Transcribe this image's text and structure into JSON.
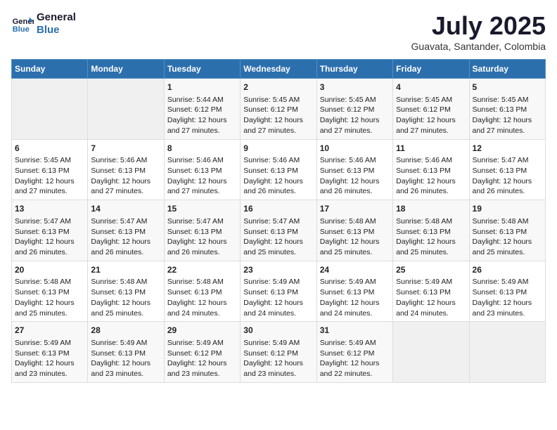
{
  "logo": {
    "line1": "General",
    "line2": "Blue"
  },
  "title": "July 2025",
  "subtitle": "Guavata, Santander, Colombia",
  "days_of_week": [
    "Sunday",
    "Monday",
    "Tuesday",
    "Wednesday",
    "Thursday",
    "Friday",
    "Saturday"
  ],
  "weeks": [
    [
      {
        "day": "",
        "empty": true
      },
      {
        "day": "",
        "empty": true
      },
      {
        "day": "1",
        "sunrise": "Sunrise: 5:44 AM",
        "sunset": "Sunset: 6:12 PM",
        "daylight": "Daylight: 12 hours and 27 minutes."
      },
      {
        "day": "2",
        "sunrise": "Sunrise: 5:45 AM",
        "sunset": "Sunset: 6:12 PM",
        "daylight": "Daylight: 12 hours and 27 minutes."
      },
      {
        "day": "3",
        "sunrise": "Sunrise: 5:45 AM",
        "sunset": "Sunset: 6:12 PM",
        "daylight": "Daylight: 12 hours and 27 minutes."
      },
      {
        "day": "4",
        "sunrise": "Sunrise: 5:45 AM",
        "sunset": "Sunset: 6:12 PM",
        "daylight": "Daylight: 12 hours and 27 minutes."
      },
      {
        "day": "5",
        "sunrise": "Sunrise: 5:45 AM",
        "sunset": "Sunset: 6:13 PM",
        "daylight": "Daylight: 12 hours and 27 minutes."
      }
    ],
    [
      {
        "day": "6",
        "sunrise": "Sunrise: 5:45 AM",
        "sunset": "Sunset: 6:13 PM",
        "daylight": "Daylight: 12 hours and 27 minutes."
      },
      {
        "day": "7",
        "sunrise": "Sunrise: 5:46 AM",
        "sunset": "Sunset: 6:13 PM",
        "daylight": "Daylight: 12 hours and 27 minutes."
      },
      {
        "day": "8",
        "sunrise": "Sunrise: 5:46 AM",
        "sunset": "Sunset: 6:13 PM",
        "daylight": "Daylight: 12 hours and 27 minutes."
      },
      {
        "day": "9",
        "sunrise": "Sunrise: 5:46 AM",
        "sunset": "Sunset: 6:13 PM",
        "daylight": "Daylight: 12 hours and 26 minutes."
      },
      {
        "day": "10",
        "sunrise": "Sunrise: 5:46 AM",
        "sunset": "Sunset: 6:13 PM",
        "daylight": "Daylight: 12 hours and 26 minutes."
      },
      {
        "day": "11",
        "sunrise": "Sunrise: 5:46 AM",
        "sunset": "Sunset: 6:13 PM",
        "daylight": "Daylight: 12 hours and 26 minutes."
      },
      {
        "day": "12",
        "sunrise": "Sunrise: 5:47 AM",
        "sunset": "Sunset: 6:13 PM",
        "daylight": "Daylight: 12 hours and 26 minutes."
      }
    ],
    [
      {
        "day": "13",
        "sunrise": "Sunrise: 5:47 AM",
        "sunset": "Sunset: 6:13 PM",
        "daylight": "Daylight: 12 hours and 26 minutes."
      },
      {
        "day": "14",
        "sunrise": "Sunrise: 5:47 AM",
        "sunset": "Sunset: 6:13 PM",
        "daylight": "Daylight: 12 hours and 26 minutes."
      },
      {
        "day": "15",
        "sunrise": "Sunrise: 5:47 AM",
        "sunset": "Sunset: 6:13 PM",
        "daylight": "Daylight: 12 hours and 26 minutes."
      },
      {
        "day": "16",
        "sunrise": "Sunrise: 5:47 AM",
        "sunset": "Sunset: 6:13 PM",
        "daylight": "Daylight: 12 hours and 25 minutes."
      },
      {
        "day": "17",
        "sunrise": "Sunrise: 5:48 AM",
        "sunset": "Sunset: 6:13 PM",
        "daylight": "Daylight: 12 hours and 25 minutes."
      },
      {
        "day": "18",
        "sunrise": "Sunrise: 5:48 AM",
        "sunset": "Sunset: 6:13 PM",
        "daylight": "Daylight: 12 hours and 25 minutes."
      },
      {
        "day": "19",
        "sunrise": "Sunrise: 5:48 AM",
        "sunset": "Sunset: 6:13 PM",
        "daylight": "Daylight: 12 hours and 25 minutes."
      }
    ],
    [
      {
        "day": "20",
        "sunrise": "Sunrise: 5:48 AM",
        "sunset": "Sunset: 6:13 PM",
        "daylight": "Daylight: 12 hours and 25 minutes."
      },
      {
        "day": "21",
        "sunrise": "Sunrise: 5:48 AM",
        "sunset": "Sunset: 6:13 PM",
        "daylight": "Daylight: 12 hours and 25 minutes."
      },
      {
        "day": "22",
        "sunrise": "Sunrise: 5:48 AM",
        "sunset": "Sunset: 6:13 PM",
        "daylight": "Daylight: 12 hours and 24 minutes."
      },
      {
        "day": "23",
        "sunrise": "Sunrise: 5:49 AM",
        "sunset": "Sunset: 6:13 PM",
        "daylight": "Daylight: 12 hours and 24 minutes."
      },
      {
        "day": "24",
        "sunrise": "Sunrise: 5:49 AM",
        "sunset": "Sunset: 6:13 PM",
        "daylight": "Daylight: 12 hours and 24 minutes."
      },
      {
        "day": "25",
        "sunrise": "Sunrise: 5:49 AM",
        "sunset": "Sunset: 6:13 PM",
        "daylight": "Daylight: 12 hours and 24 minutes."
      },
      {
        "day": "26",
        "sunrise": "Sunrise: 5:49 AM",
        "sunset": "Sunset: 6:13 PM",
        "daylight": "Daylight: 12 hours and 23 minutes."
      }
    ],
    [
      {
        "day": "27",
        "sunrise": "Sunrise: 5:49 AM",
        "sunset": "Sunset: 6:13 PM",
        "daylight": "Daylight: 12 hours and 23 minutes."
      },
      {
        "day": "28",
        "sunrise": "Sunrise: 5:49 AM",
        "sunset": "Sunset: 6:13 PM",
        "daylight": "Daylight: 12 hours and 23 minutes."
      },
      {
        "day": "29",
        "sunrise": "Sunrise: 5:49 AM",
        "sunset": "Sunset: 6:12 PM",
        "daylight": "Daylight: 12 hours and 23 minutes."
      },
      {
        "day": "30",
        "sunrise": "Sunrise: 5:49 AM",
        "sunset": "Sunset: 6:12 PM",
        "daylight": "Daylight: 12 hours and 23 minutes."
      },
      {
        "day": "31",
        "sunrise": "Sunrise: 5:49 AM",
        "sunset": "Sunset: 6:12 PM",
        "daylight": "Daylight: 12 hours and 22 minutes."
      },
      {
        "day": "",
        "empty": true
      },
      {
        "day": "",
        "empty": true
      }
    ]
  ]
}
